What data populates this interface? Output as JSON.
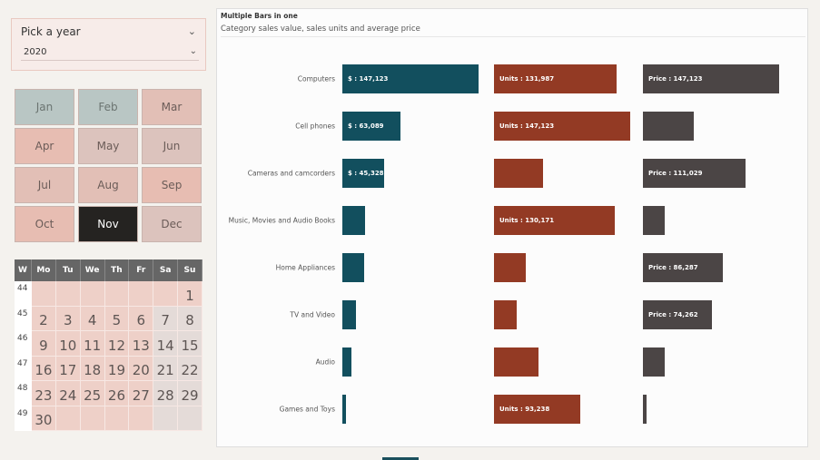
{
  "year_slicer": {
    "heading": "Pick a year",
    "selected": "2020"
  },
  "months": [
    {
      "label": "Jan",
      "bg": "#b9c6c4",
      "fg": "#6b7471"
    },
    {
      "label": "Feb",
      "bg": "#b9c6c4",
      "fg": "#6b7471"
    },
    {
      "label": "Mar",
      "bg": "#e2bfb6",
      "fg": "#6b5c58"
    },
    {
      "label": "Apr",
      "bg": "#e7bdb2",
      "fg": "#6b5c58"
    },
    {
      "label": "May",
      "bg": "#dcc3bd",
      "fg": "#6b5c58"
    },
    {
      "label": "Jun",
      "bg": "#dcc3bd",
      "fg": "#6b5c58"
    },
    {
      "label": "Jul",
      "bg": "#e2bfb6",
      "fg": "#6b5c58"
    },
    {
      "label": "Aug",
      "bg": "#e2bfb6",
      "fg": "#6b5c58"
    },
    {
      "label": "Sep",
      "bg": "#e7bdb2",
      "fg": "#6b5c58"
    },
    {
      "label": "Oct",
      "bg": "#e7bdb2",
      "fg": "#6b5c58"
    },
    {
      "label": "Nov",
      "bg": "#252321",
      "fg": "#ffffff",
      "selected": true
    },
    {
      "label": "Dec",
      "bg": "#dcc3bd",
      "fg": "#6b5c58"
    }
  ],
  "calendar": {
    "headers": [
      "W",
      "Mo",
      "Tu",
      "We",
      "Th",
      "Fr",
      "Sa",
      "Su"
    ],
    "weeks": [
      {
        "week": "44",
        "days": [
          "",
          "",
          "",
          "",
          "",
          "",
          "1"
        ]
      },
      {
        "week": "45",
        "days": [
          "2",
          "3",
          "4",
          "5",
          "6",
          "7",
          "8"
        ]
      },
      {
        "week": "46",
        "days": [
          "9",
          "10",
          "11",
          "12",
          "13",
          "14",
          "15"
        ]
      },
      {
        "week": "47",
        "days": [
          "16",
          "17",
          "18",
          "19",
          "20",
          "21",
          "22"
        ]
      },
      {
        "week": "48",
        "days": [
          "23",
          "24",
          "25",
          "26",
          "27",
          "28",
          "29"
        ]
      },
      {
        "week": "49",
        "days": [
          "30",
          "",
          "",
          "",
          "",
          "",
          ""
        ]
      }
    ]
  },
  "chart_data": {
    "type": "bar",
    "title": "Multiple Bars in one",
    "subtitle": "Category sales value, sales units and average price",
    "categories": [
      "Computers",
      "Cell phones",
      "Cameras and camcorders",
      "Music, Movies and Audio Books",
      "Home Appliances",
      "TV and Video",
      "Audio",
      "Games and Toys"
    ],
    "series": [
      {
        "key": "value",
        "color": "#124f5e",
        "label_prefix": "$ : ",
        "values": [
          147123,
          63089,
          45328,
          25000,
          23500,
          15000,
          9500,
          4000
        ],
        "labels": [
          "$ : 147,123",
          "$ : 63,089",
          "$ : 45,328",
          "",
          "",
          "",
          "",
          ""
        ]
      },
      {
        "key": "units",
        "color": "#933a24",
        "label_prefix": "Units : ",
        "values": [
          131987,
          147123,
          52500,
          130171,
          34500,
          25000,
          48000,
          93238
        ],
        "labels": [
          "Units : 131,987",
          "Units : 147,123",
          "",
          "Units : 130,171",
          "",
          "",
          "",
          "Units : 93,238"
        ]
      },
      {
        "key": "price",
        "color": "#4b4545",
        "label_prefix": "Price : ",
        "values": [
          147123,
          55000,
          111029,
          23500,
          86287,
          74262,
          23500,
          4000
        ],
        "labels": [
          "Price : 147,123",
          "",
          "Price : 111,029",
          "",
          "Price : 86,287",
          "Price : 74,262",
          "",
          ""
        ]
      }
    ]
  }
}
